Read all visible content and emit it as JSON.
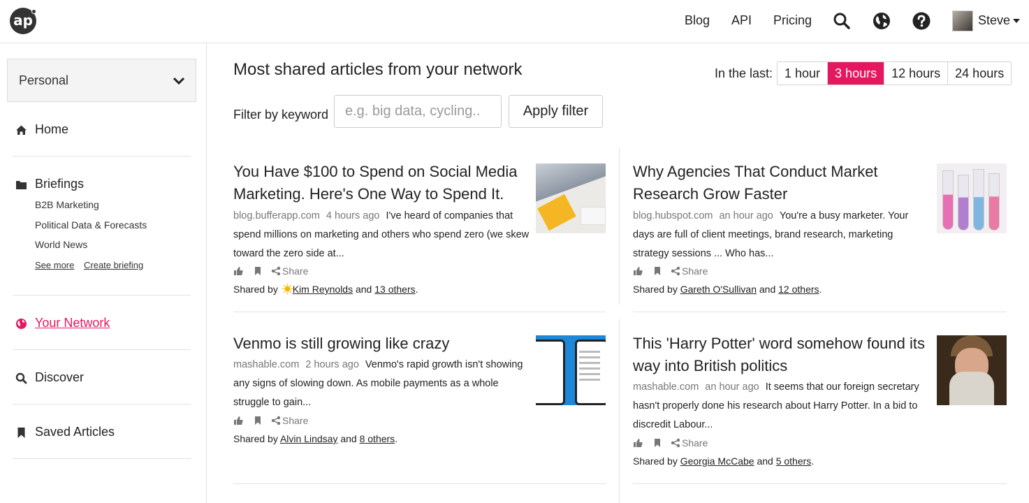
{
  "topbar": {
    "logo_text": "ap",
    "nav": [
      "Blog",
      "API",
      "Pricing"
    ],
    "icons": [
      "search-icon",
      "globe-icon",
      "help-icon"
    ],
    "user": "Steve"
  },
  "sidebar": {
    "dropdown": "Personal",
    "home": "Home",
    "briefings": "Briefings",
    "briefing_items": [
      "B2B Marketing",
      "Political Data & Forecasts",
      "World News"
    ],
    "see_more": "See more",
    "create_briefing": "Create briefing",
    "your_network": "Your Network",
    "discover": "Discover",
    "saved": "Saved Articles"
  },
  "main": {
    "title": "Most shared articles from your network",
    "in_the_last": "In the last:",
    "time_options": [
      "1 hour",
      "3 hours",
      "12 hours",
      "24 hours"
    ],
    "selected_time": "3 hours",
    "filter_label": "Filter by keyword",
    "filter_placeholder": "e.g. big data, cycling..",
    "apply": "Apply filter",
    "share_label": "Share",
    "shared_by": "Shared by",
    "and": "and",
    "articles": [
      {
        "title_l1": "You Have $100 to Spend on Social Media",
        "title_l2": "Marketing. Here's One Way to Spend It.",
        "source": "blog.bufferapp.com",
        "ago": "4 hours ago",
        "snip_l1": "I've heard of companies that",
        "snip_l2": "spend millions on marketing and others who spend zero (we skew",
        "snip_l3": "toward the zero side at...",
        "sharer": "Kim Reynolds",
        "others": "13 others"
      },
      {
        "title_l1": "Why Agencies That Conduct Market",
        "title_l2": "Research Grow Faster",
        "source": "blog.hubspot.com",
        "ago": "an hour ago",
        "snip_l1": "You're a busy marketer. Your",
        "snip_l2": "days are full of client meetings, brand research, marketing",
        "snip_l3": "strategy sessions ... Who has...",
        "sharer": "Gareth O'Sullivan",
        "others": "12 others"
      },
      {
        "title_l1": "Venmo is still growing like crazy",
        "source": "mashable.com",
        "ago": "2 hours ago",
        "snip_l1": "Venmo's rapid growth isn't showing",
        "snip_l2": "any signs of slowing down. As mobile payments as a whole",
        "snip_l3": "struggle to gain...",
        "sharer": "Alvin Lindsay",
        "others": "8 others"
      },
      {
        "title_l1": "This 'Harry Potter' word somehow found its",
        "title_l2": "way into British politics",
        "source": "mashable.com",
        "ago": "an hour ago",
        "snip_l1": "It seems that our foreign secretary",
        "snip_l2": "hasn't properly done his research about Harry Potter. In a bid to",
        "snip_l3": "discredit Labour...",
        "sharer": "Georgia McCabe",
        "others": "5 others"
      }
    ]
  },
  "colors": {
    "accent": "#e5185f"
  }
}
